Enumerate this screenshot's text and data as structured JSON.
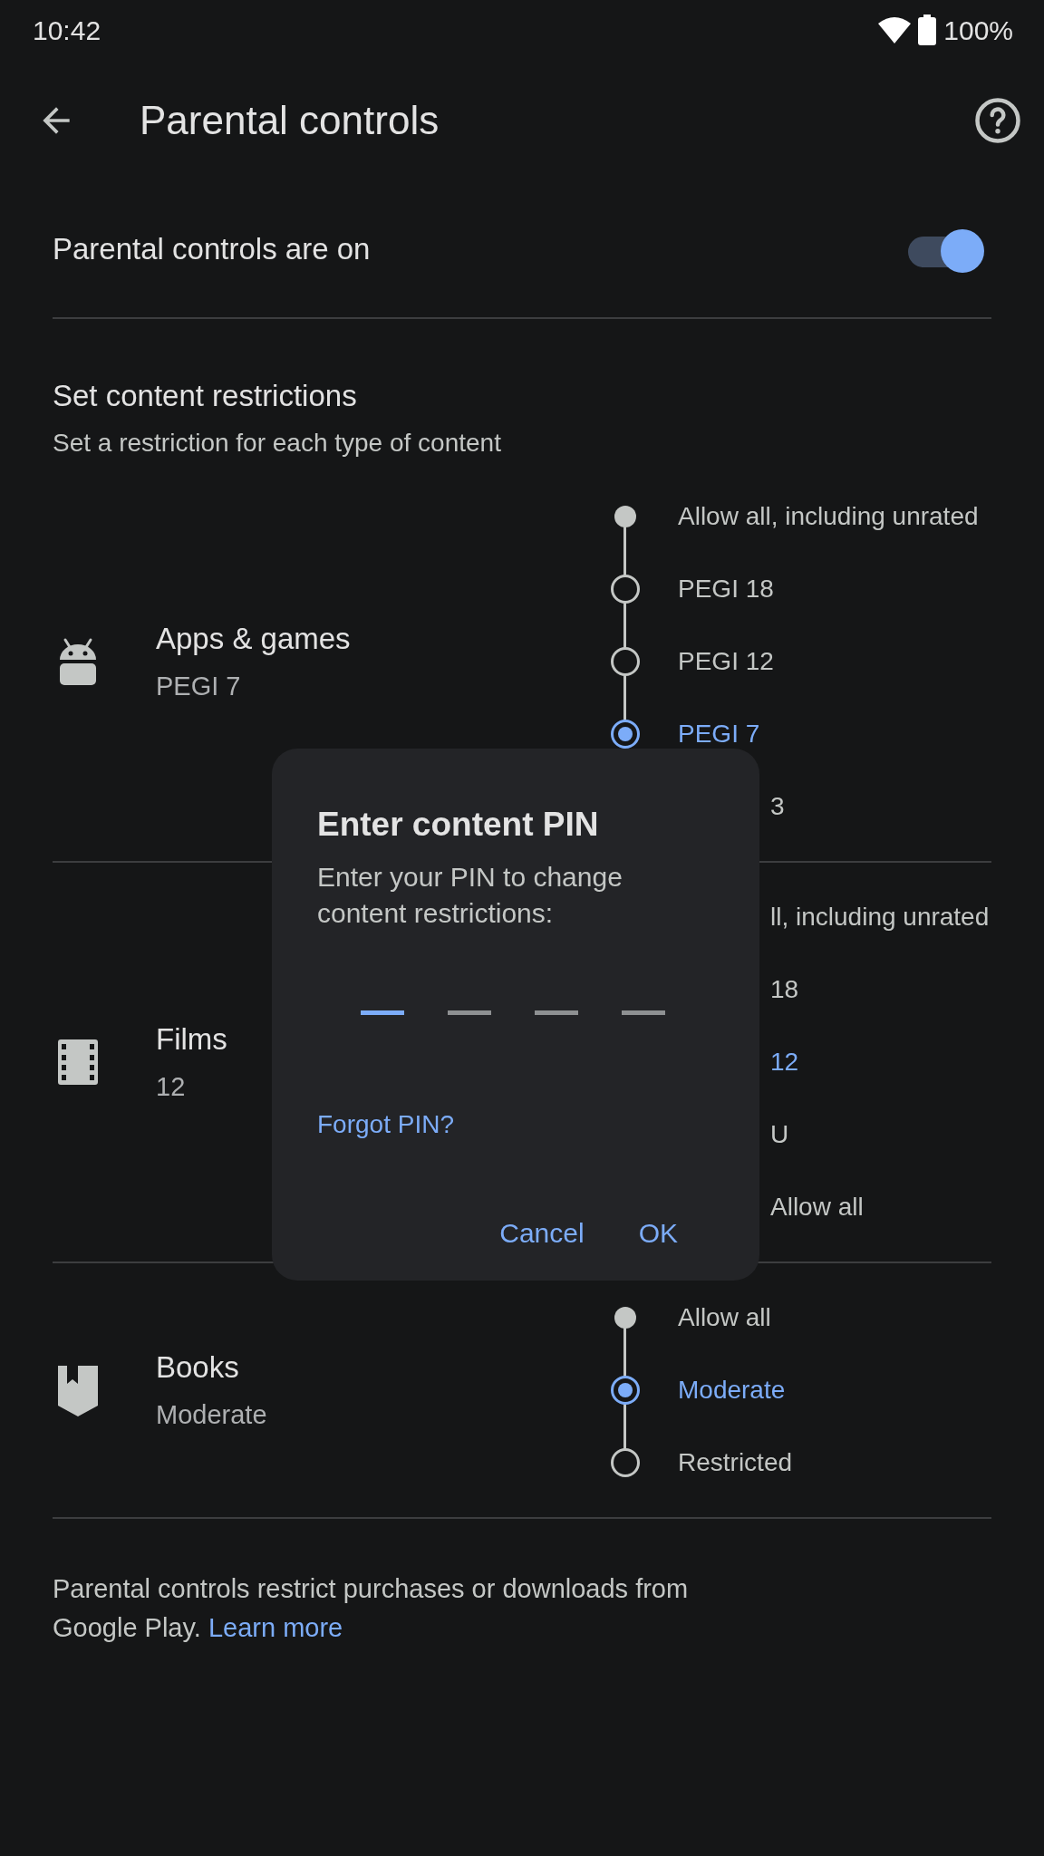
{
  "status_bar": {
    "time": "10:42",
    "battery": "100%"
  },
  "toolbar": {
    "title": "Parental controls"
  },
  "master": {
    "label": "Parental controls are on",
    "on": true
  },
  "restrictions": {
    "title": "Set content restrictions",
    "subtitle": "Set a restriction for each type of content"
  },
  "categories": [
    {
      "kind": "apps",
      "title": "Apps & games",
      "value": "PEGI 7",
      "options": [
        {
          "kind": "top",
          "label": "Allow all, including unrated",
          "selected": false
        },
        {
          "kind": "step",
          "label": "PEGI 18",
          "selected": false
        },
        {
          "kind": "step",
          "label": "PEGI 12",
          "selected": false
        },
        {
          "kind": "step",
          "label": "PEGI 7",
          "selected": true
        },
        {
          "kind": "plain",
          "label": "3",
          "selected": false
        }
      ]
    },
    {
      "kind": "films",
      "title": "Films",
      "value": "12",
      "options": [
        {
          "kind": "plain",
          "label": "ll, including unrated",
          "selected": false
        },
        {
          "kind": "plain",
          "label": "18",
          "selected": false
        },
        {
          "kind": "plain",
          "label": "12",
          "selected": true
        },
        {
          "kind": "plain",
          "label": "U",
          "selected": false
        },
        {
          "kind": "plain",
          "label": "Allow all",
          "selected": false
        }
      ]
    },
    {
      "kind": "books",
      "title": "Books",
      "value": "Moderate",
      "options": [
        {
          "kind": "top",
          "label": "Allow all",
          "selected": false
        },
        {
          "kind": "step",
          "label": "Moderate",
          "selected": true
        },
        {
          "kind": "step",
          "label": "Restricted",
          "selected": false
        }
      ]
    }
  ],
  "footer": {
    "text": "Parental controls restrict purchases or downloads from Google Play.",
    "link": "Learn more"
  },
  "dialog": {
    "title": "Enter content PIN",
    "message": "Enter your PIN to change content restrictions:",
    "pin_slots": [
      {
        "focused": true
      },
      {
        "focused": false
      },
      {
        "focused": false
      },
      {
        "focused": false
      }
    ],
    "forgot": "Forgot PIN?",
    "buttons": [
      "Cancel",
      "OK"
    ]
  }
}
